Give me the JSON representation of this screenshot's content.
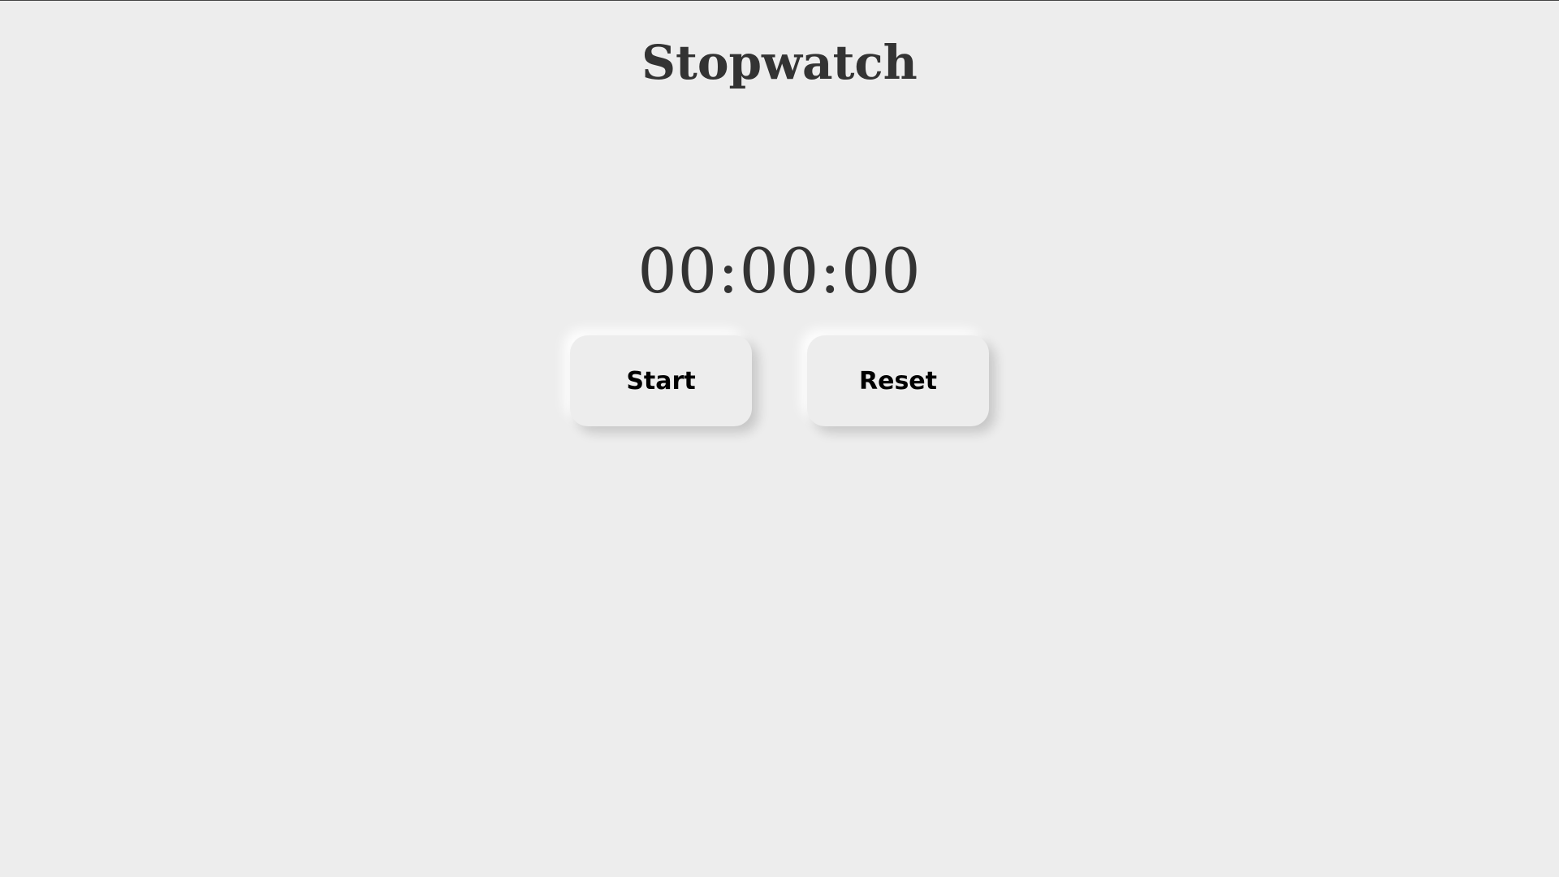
{
  "app": {
    "title": "Stopwatch"
  },
  "timer": {
    "display": "00:00:00"
  },
  "controls": {
    "start_label": "Start",
    "reset_label": "Reset"
  }
}
